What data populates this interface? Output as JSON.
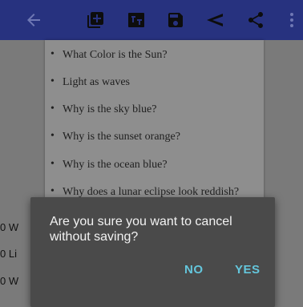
{
  "appbar": {
    "icons": [
      "back-arrow-icon",
      "add-box-icon",
      "translate-icon",
      "save-icon",
      "send-icon",
      "share-icon",
      "more-vert-icon"
    ]
  },
  "questions": [
    "What Color is the Sun?",
    "Light as waves",
    "Why is the sky blue?",
    "Why is the sunset orange?",
    "Why is the ocean blue?",
    "Why does a lunar eclipse look reddish?"
  ],
  "side_items": [
    "0 W",
    "0 Li",
    "0 W"
  ],
  "dialog": {
    "message": "Are you sure you want to cancel without saving?",
    "no_label": "NO",
    "yes_label": "YES"
  }
}
